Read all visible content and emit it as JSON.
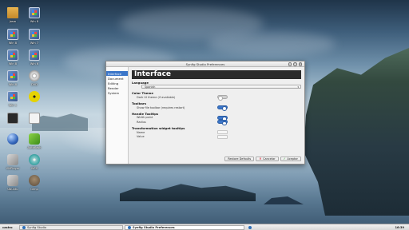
{
  "desktop": {
    "icons": [
      {
        "label": "Josm",
        "icon": "folder-icon"
      },
      {
        "label": "Win 8",
        "icon": "windows-icon"
      },
      {
        "label": "Win 8",
        "icon": "windows-icon"
      },
      {
        "label": "Win 7",
        "icon": "windows-icon"
      },
      {
        "label": "Win 8",
        "icon": "windows-icon"
      },
      {
        "label": "Win 6",
        "icon": "windows-icon"
      },
      {
        "label": "Win 8",
        "icon": "windows-icon"
      },
      {
        "label": "DVD",
        "icon": "dvd-icon"
      },
      {
        "label": "Win 1",
        "icon": "windows-icon"
      },
      {
        "label": "",
        "icon": "radiation-icon"
      },
      {
        "label": "",
        "icon": "terminal-icon"
      },
      {
        "label": "",
        "icon": "document-icon"
      },
      {
        "label": "",
        "icon": "globe-icon"
      },
      {
        "label": "Autoflash",
        "icon": "green-app-icon"
      },
      {
        "label": "VMPlayer",
        "icon": "gray-app-icon"
      },
      {
        "label": "WPS",
        "icon": "disc-icon"
      },
      {
        "label": "Ubuntu",
        "icon": "gray-app-icon"
      },
      {
        "label": "Gimp",
        "icon": "gimp-icon"
      },
      {
        "label": "Mea",
        "icon": "purple-app-icon"
      }
    ]
  },
  "taskbar": {
    "user": "castro",
    "tasks": [
      {
        "label": "Synfig Studio",
        "active": false
      },
      {
        "label": "Synfig Studio Preferences",
        "active": true
      }
    ],
    "clock": "16:39"
  },
  "dialog": {
    "title": "Synfig Studio Preferences",
    "sidebar": [
      "Interface",
      "Document",
      "Editing",
      "Render",
      "System"
    ],
    "selected": "Interface",
    "banner": "Interface",
    "language_label": "Language",
    "language_value": "Spanish",
    "sections": [
      {
        "title": "Color Theme",
        "rows": [
          {
            "label": "Dark UI theme (if available)",
            "control": "switch",
            "state": "off"
          }
        ]
      },
      {
        "title": "Toolbars",
        "rows": [
          {
            "label": "Show file toolbar (requires restart)",
            "control": "switch",
            "state": "on"
          }
        ]
      },
      {
        "title": "Handle Tooltips",
        "rows": [
          {
            "label": "Width point",
            "control": "switch",
            "state": "on"
          },
          {
            "label": "Radius",
            "control": "switch",
            "state": "on"
          }
        ]
      },
      {
        "title": "Transformation widget tooltips",
        "rows": [
          {
            "label": "Name",
            "control": "field",
            "state": "disabled"
          },
          {
            "label": "Value",
            "control": "field",
            "state": "disabled"
          }
        ]
      }
    ],
    "buttons": {
      "restore": "Restore Defaults",
      "cancel": "Cancelar",
      "apply": "Aceptar"
    }
  }
}
